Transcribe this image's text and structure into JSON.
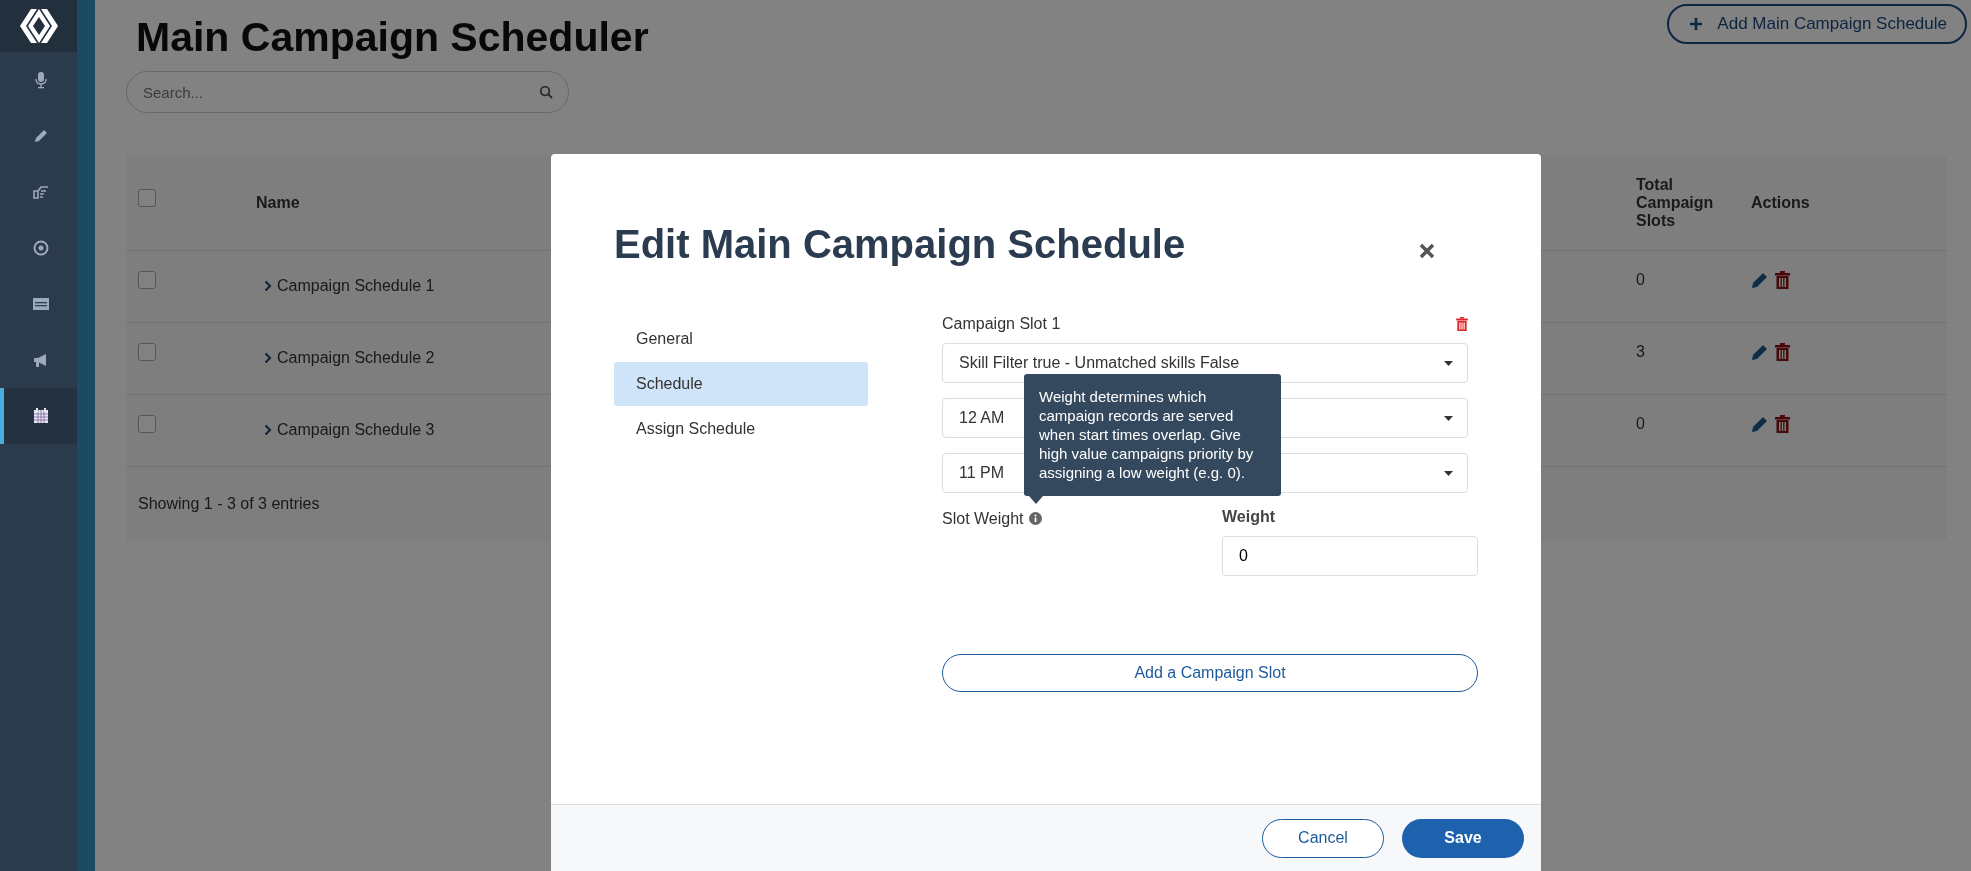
{
  "sidebar": {
    "items": [
      {
        "selected": false
      },
      {
        "selected": false
      },
      {
        "selected": false
      },
      {
        "selected": false
      },
      {
        "selected": false
      },
      {
        "selected": false
      },
      {
        "selected": true
      }
    ]
  },
  "page": {
    "title": "Main Campaign Scheduler",
    "search": {
      "placeholder": "Search..."
    },
    "add_button": "Add Main Campaign Schedule"
  },
  "table": {
    "header_checked": false,
    "columns": [
      "Name",
      "Total Campaign Slots",
      "Actions"
    ],
    "rows": [
      {
        "checked": false,
        "name": "Campaign Schedule 1",
        "total_campaign_slots": "0"
      },
      {
        "checked": false,
        "name": "Campaign Schedule 2",
        "total_campaign_slots": "3"
      },
      {
        "checked": false,
        "name": "Campaign Schedule 3",
        "total_campaign_slots": "0"
      }
    ],
    "footer": "Showing 1 - 3 of 3 entries"
  },
  "modal": {
    "title": "Edit Main Campaign Schedule",
    "nav": [
      {
        "label": "General",
        "selected": false
      },
      {
        "label": "Schedule",
        "selected": true
      },
      {
        "label": "Assign Schedule",
        "selected": false
      }
    ],
    "slot": {
      "title": "Campaign Slot 1",
      "selects": [
        "Skill Filter true - Unmatched skills False",
        "12 AM",
        "11 PM"
      ],
      "slot_weight_label": "Slot Weight",
      "weight_label": "Weight",
      "weight_value": "0",
      "tooltip": "Weight determines which campaign records are served when start times overlap. Give high value campaigns priority by assigning a low weight (e.g. 0)."
    },
    "add_slot_button": "Add a Campaign Slot",
    "cancel_button": "Cancel",
    "save_button": "Save"
  }
}
